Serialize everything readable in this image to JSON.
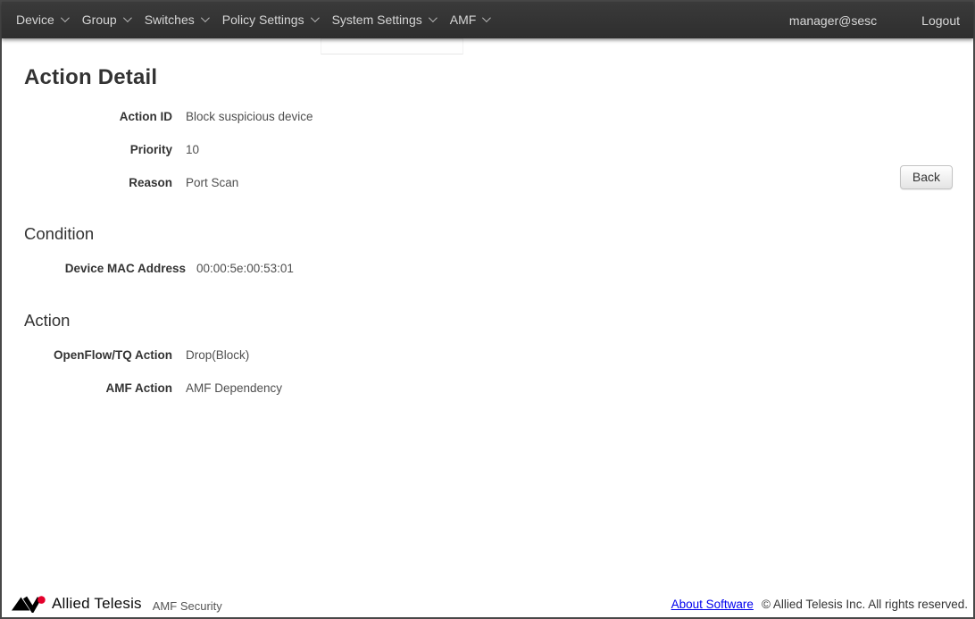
{
  "navbar": {
    "background": "#333333",
    "text_color": "#d6d6d6",
    "items": [
      {
        "label": "Device"
      },
      {
        "label": "Group"
      },
      {
        "label": "Switches"
      },
      {
        "label": "Policy Settings"
      },
      {
        "label": "System Settings"
      },
      {
        "label": "AMF"
      }
    ],
    "user": "manager@sesc",
    "logout_label": "Logout"
  },
  "page": {
    "title": "Action Detail",
    "back_button_label": "Back",
    "detail_fields": [
      {
        "label": "Action ID",
        "value": "Block suspicious device"
      },
      {
        "label": "Priority",
        "value": "10"
      },
      {
        "label": "Reason",
        "value": "Port Scan"
      }
    ],
    "condition_section": {
      "title": "Condition",
      "fields": [
        {
          "label": "Device MAC Address",
          "value": "00:00:5e:00:53:01"
        }
      ]
    },
    "action_section": {
      "title": "Action",
      "fields": [
        {
          "label": "OpenFlow/TQ Action",
          "value": "Drop(Block)"
        },
        {
          "label": "AMF Action",
          "value": "AMF Dependency"
        }
      ]
    }
  },
  "footer": {
    "brand": "Allied Telesis",
    "product": "AMF Security",
    "about_link_label": "About Software",
    "copyright": "© Allied Telesis Inc. All rights reserved.",
    "link_color": "#0000ee",
    "logo_red": "#e4002b"
  }
}
